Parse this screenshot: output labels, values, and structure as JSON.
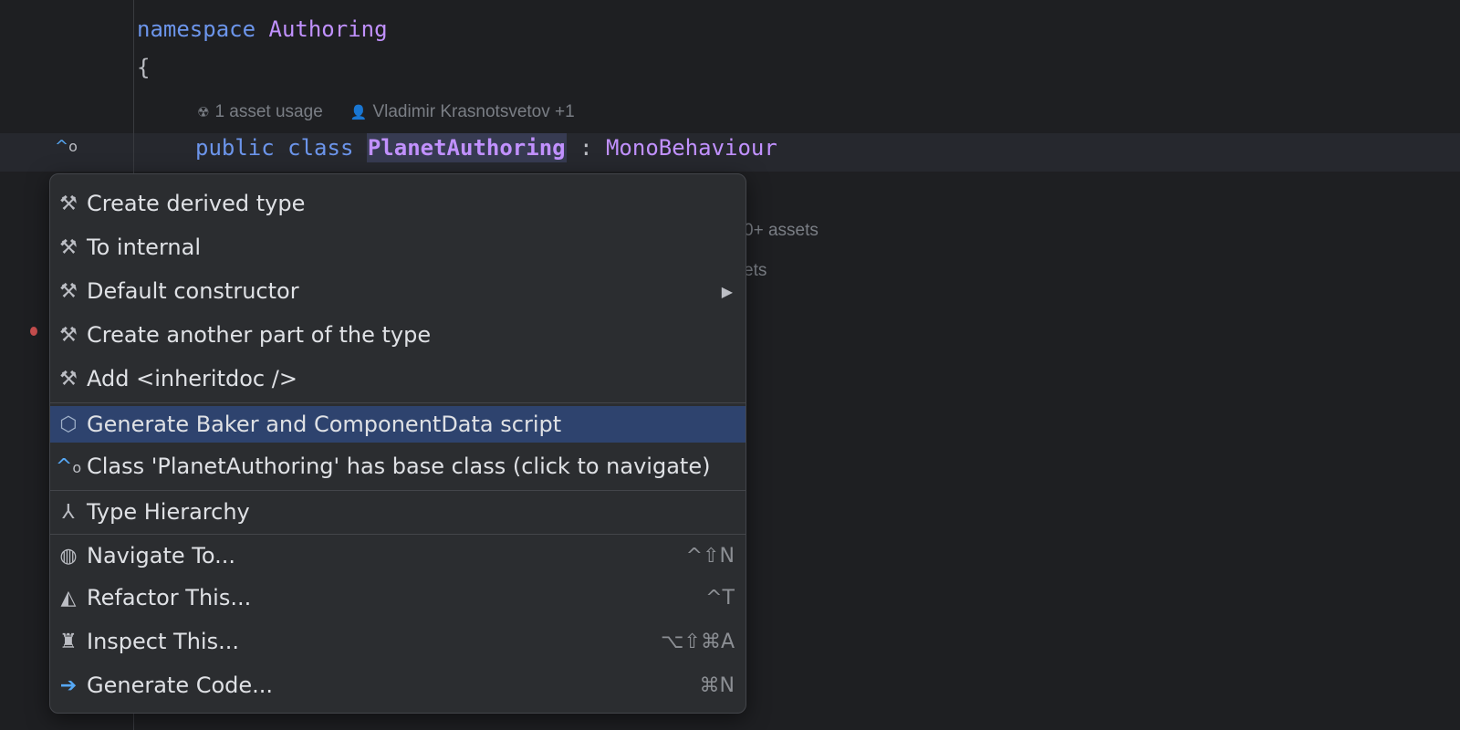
{
  "code": {
    "namespace_kw": "namespace",
    "namespace_name": "Authoring",
    "open_brace": "{",
    "hint_usage": "1 asset usage",
    "hint_author": "Vladimir Krasnotsvetov +1",
    "public_kw": "public",
    "class_kw": "class",
    "class_name": "PlanetAuthoring",
    "colon": ":",
    "base_class": "MonoBehaviour",
    "partial_hint_1": "0+ assets",
    "partial_hint_2": "ets"
  },
  "menu": {
    "items": [
      {
        "label": "Create derived type",
        "icon": "hammer-icon"
      },
      {
        "label": "To internal",
        "icon": "hammer-icon"
      },
      {
        "label": "Default constructor",
        "icon": "hammer-icon",
        "submenu": true
      },
      {
        "label": "Create another part of the type",
        "icon": "hammer-icon"
      },
      {
        "label": "Add <inheritdoc />",
        "icon": "hammer-icon"
      },
      {
        "label": "Generate Baker and ComponentData script",
        "icon": "unity-icon",
        "selected": true
      },
      {
        "label": "Class 'PlanetAuthoring' has base class (click to navigate)",
        "icon": "base-class-icon"
      },
      {
        "label": "Type Hierarchy",
        "icon": "hierarchy-icon"
      },
      {
        "label": "Navigate To...",
        "icon": "navigate-icon",
        "shortcut": "^⇧N"
      },
      {
        "label": "Refactor This...",
        "icon": "refactor-icon",
        "shortcut": "^T"
      },
      {
        "label": "Inspect This...",
        "icon": "inspect-icon",
        "shortcut": "⌥⇧⌘A"
      },
      {
        "label": "Generate Code...",
        "icon": "generate-code-icon",
        "shortcut": "⌘N"
      }
    ]
  },
  "colors": {
    "background": "#1e1f22",
    "popup": "#2b2d30",
    "selection": "#2e436e",
    "keyword": "#6c95eb",
    "type_name": "#c191ff"
  }
}
